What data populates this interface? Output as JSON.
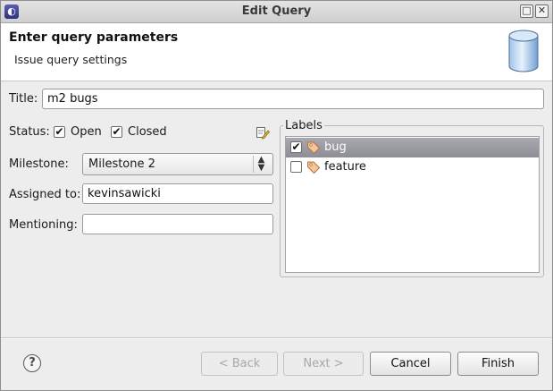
{
  "window": {
    "title": "Edit Query",
    "max_glyph": "□",
    "close_glyph": "✕"
  },
  "header": {
    "title": "Enter query parameters",
    "subtitle": "Issue query settings"
  },
  "form": {
    "title_label": "Title:",
    "title_value": "m2 bugs",
    "status_label": "Status:",
    "status_open": {
      "label": "Open",
      "checked": true
    },
    "status_closed": {
      "label": "Closed",
      "checked": true
    },
    "milestone_label": "Milestone:",
    "milestone_value": "Milestone 2",
    "assigned_label": "Assigned to:",
    "assigned_value": "kevinsawicki",
    "mentioning_label": "Mentioning:",
    "mentioning_value": ""
  },
  "labels_group": {
    "title": "Labels",
    "items": [
      {
        "label": "bug",
        "checked": true,
        "selected": true
      },
      {
        "label": "feature",
        "checked": false,
        "selected": false
      }
    ]
  },
  "footer": {
    "help_glyph": "?",
    "back_label": "< Back",
    "next_label": "Next >",
    "cancel_label": "Cancel",
    "finish_label": "Finish"
  },
  "icons": {
    "app": "eclipse-icon",
    "header": "database-icon",
    "status_edit": "edit-query-icon",
    "tag": "tag-icon",
    "help": "help-icon"
  }
}
